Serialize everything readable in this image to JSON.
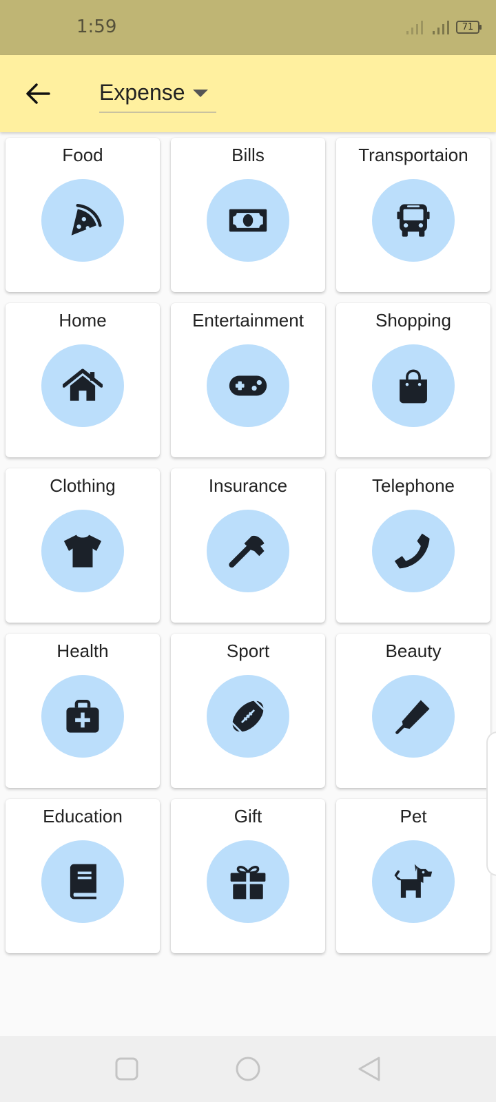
{
  "status_bar": {
    "time": "1:59",
    "battery": "71"
  },
  "header": {
    "dropdown_value": "Expense"
  },
  "categories": [
    {
      "label": "Food",
      "icon": "pizza-icon"
    },
    {
      "label": "Bills",
      "icon": "money-bill-icon"
    },
    {
      "label": "Transportaion",
      "icon": "bus-icon"
    },
    {
      "label": "Home",
      "icon": "house-icon"
    },
    {
      "label": "Entertainment",
      "icon": "gamepad-icon"
    },
    {
      "label": "Shopping",
      "icon": "shopping-bag-icon"
    },
    {
      "label": "Clothing",
      "icon": "tshirt-icon"
    },
    {
      "label": "Insurance",
      "icon": "hammer-icon"
    },
    {
      "label": "Telephone",
      "icon": "phone-icon"
    },
    {
      "label": "Health",
      "icon": "medkit-icon"
    },
    {
      "label": "Sport",
      "icon": "football-icon"
    },
    {
      "label": "Beauty",
      "icon": "pen-icon"
    },
    {
      "label": "Education",
      "icon": "book-icon"
    },
    {
      "label": "Gift",
      "icon": "gift-icon"
    },
    {
      "label": "Pet",
      "icon": "dog-icon"
    }
  ],
  "colors": {
    "status_bar": "#bfb574",
    "app_bar": "#fff09f",
    "icon_circle": "#bbdefb",
    "icon": "#1b2129"
  }
}
